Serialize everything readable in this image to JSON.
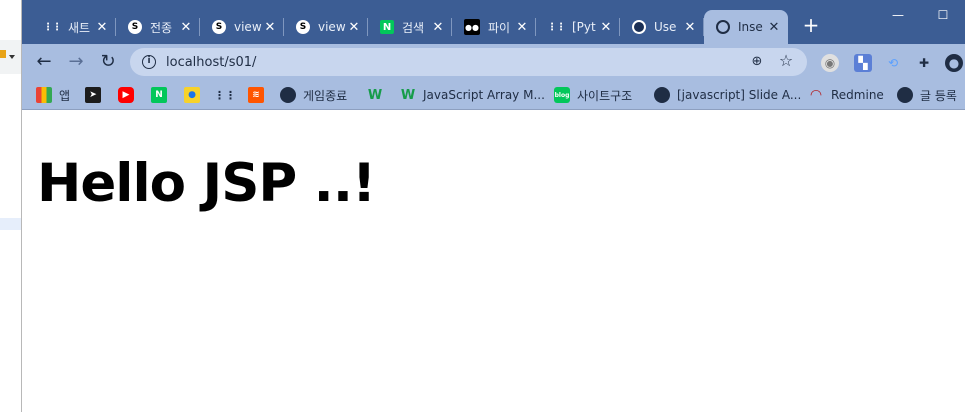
{
  "tabs": [
    {
      "title": "새트",
      "favicon": "dots-icon"
    },
    {
      "title": "전종",
      "favicon": "s-icon"
    },
    {
      "title": "view",
      "favicon": "s-icon"
    },
    {
      "title": "view",
      "favicon": "s-icon"
    },
    {
      "title": "검색",
      "favicon": "naver-icon"
    },
    {
      "title": "파이",
      "favicon": "medium-icon"
    },
    {
      "title": "[Pyt",
      "favicon": "dots-icon"
    },
    {
      "title": "Use",
      "favicon": "globe-icon"
    },
    {
      "title": "Inse",
      "favicon": "globe-icon",
      "active": true
    }
  ],
  "tab_close_glyph": "✕",
  "new_tab_glyph": "+",
  "window_controls": {
    "minimize": "—",
    "maximize": "☐"
  },
  "toolbar": {
    "back": "←",
    "forward": "→",
    "reload": "↻",
    "info": "i",
    "url": "localhost/s01/",
    "zoom": "⊕",
    "star": "☆"
  },
  "bookmarks": [
    {
      "label": "앱",
      "icon": "apps-grid-icon"
    },
    {
      "label": "",
      "icon": "dark-app-icon"
    },
    {
      "label": "",
      "icon": "youtube-icon"
    },
    {
      "label": "",
      "icon": "naver-icon"
    },
    {
      "label": "",
      "icon": "map-pin-icon"
    },
    {
      "label": "",
      "icon": "dots-icon"
    },
    {
      "label": "",
      "icon": "soundcloud-icon"
    },
    {
      "label": "게임종료",
      "icon": "globe-icon"
    },
    {
      "label": "",
      "icon": "w-icon"
    },
    {
      "label": "JavaScript Array M...",
      "icon": "w-icon"
    },
    {
      "label": "사이트구조",
      "icon": "blog-icon"
    },
    {
      "label": "[javascript] Slide A...",
      "icon": "globe-icon"
    },
    {
      "label": "Redmine",
      "icon": "redmine-icon"
    },
    {
      "label": "글 등록",
      "icon": "globe-icon"
    }
  ],
  "page": {
    "heading": "Hello JSP ..!"
  },
  "colors": {
    "frame": "#3c5d94",
    "toolbar": "#a8bde0",
    "omnibox": "#c8d6ee"
  }
}
